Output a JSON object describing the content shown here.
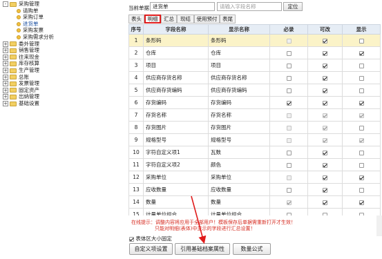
{
  "tree": [
    {
      "label": "采购管理",
      "level": 1,
      "kind": "folder",
      "toggle": "-"
    },
    {
      "label": "请购单",
      "level": 2,
      "kind": "leaf"
    },
    {
      "label": "采购订单",
      "level": 2,
      "kind": "leaf"
    },
    {
      "label": "进货单",
      "level": 2,
      "kind": "leaf",
      "selected": true
    },
    {
      "label": "采购发票",
      "level": 2,
      "kind": "leaf"
    },
    {
      "label": "采购需求分析",
      "level": 2,
      "kind": "leaf"
    },
    {
      "label": "委外管理",
      "level": 0,
      "kind": "folder",
      "toggle": "+"
    },
    {
      "label": "销售管理",
      "level": 0,
      "kind": "folder",
      "toggle": "+"
    },
    {
      "label": "往来现金",
      "level": 0,
      "kind": "folder",
      "toggle": "+"
    },
    {
      "label": "库存核算",
      "level": 0,
      "kind": "folder",
      "toggle": "+"
    },
    {
      "label": "生产管理",
      "level": 0,
      "kind": "folder",
      "toggle": "+"
    },
    {
      "label": "总账",
      "level": 0,
      "kind": "folder",
      "toggle": "+"
    },
    {
      "label": "发票管理",
      "level": 0,
      "kind": "folder",
      "toggle": "+"
    },
    {
      "label": "固定资产",
      "level": 0,
      "kind": "folder",
      "toggle": "+"
    },
    {
      "label": "出纳管理",
      "level": 0,
      "kind": "folder",
      "toggle": "+"
    },
    {
      "label": "基础设置",
      "level": 0,
      "kind": "folder",
      "toggle": "+"
    }
  ],
  "header": {
    "current_doc_label": "当前单据",
    "current_doc_value": "进货单",
    "search_placeholder": "请输入字段名称",
    "locate_button": "定位"
  },
  "tabs": [
    "表头",
    "明细",
    "汇总",
    "现结",
    "使用预付",
    "表尾"
  ],
  "active_tab": "明细",
  "grid": {
    "columns": [
      "序号",
      "字段名称",
      "显示名称",
      "必录",
      "可改",
      "显示"
    ],
    "rows": [
      {
        "no": "1",
        "field": "条形码",
        "display": "条形码",
        "req": false,
        "edit": true,
        "show": false,
        "req_dis": true,
        "edit_dis": false,
        "show_dis": false
      },
      {
        "no": "2",
        "field": "仓库",
        "display": "仓库",
        "req": false,
        "edit": true,
        "show": true,
        "req_dis": false,
        "edit_dis": false,
        "show_dis": false
      },
      {
        "no": "3",
        "field": "项目",
        "display": "项目",
        "req": false,
        "edit": true,
        "show": false,
        "req_dis": false,
        "edit_dis": false,
        "show_dis": false
      },
      {
        "no": "4",
        "field": "供应商存货名称",
        "display": "供应商存货名称",
        "req": false,
        "edit": true,
        "show": false,
        "req_dis": false,
        "edit_dis": false,
        "show_dis": false
      },
      {
        "no": "5",
        "field": "供应商存货编码",
        "display": "供应商存货编码",
        "req": false,
        "edit": true,
        "show": false,
        "req_dis": false,
        "edit_dis": false,
        "show_dis": false
      },
      {
        "no": "6",
        "field": "存货编码",
        "display": "存货编码",
        "req": true,
        "edit": true,
        "show": true,
        "req_dis": false,
        "edit_dis": false,
        "show_dis": false
      },
      {
        "no": "7",
        "field": "存货名称",
        "display": "存货名称",
        "req": false,
        "edit": true,
        "show": true,
        "req_dis": true,
        "edit_dis": true,
        "show_dis": true
      },
      {
        "no": "8",
        "field": "存货图片",
        "display": "存货图片",
        "req": false,
        "edit": true,
        "show": false,
        "req_dis": true,
        "edit_dis": true,
        "show_dis": false
      },
      {
        "no": "9",
        "field": "规格型号",
        "display": "规格型号",
        "req": false,
        "edit": true,
        "show": true,
        "req_dis": true,
        "edit_dis": true,
        "show_dis": true
      },
      {
        "no": "10",
        "field": "字符自定义项1",
        "display": "瓦数",
        "req": false,
        "edit": true,
        "show": false,
        "req_dis": false,
        "edit_dis": false,
        "show_dis": false
      },
      {
        "no": "11",
        "field": "字符自定义项2",
        "display": "颜色",
        "req": false,
        "edit": true,
        "show": false,
        "req_dis": false,
        "edit_dis": false,
        "show_dis": false
      },
      {
        "no": "12",
        "field": "采购单位",
        "display": "采购单位",
        "req": false,
        "edit": true,
        "show": true,
        "req_dis": true,
        "edit_dis": false,
        "show_dis": false
      },
      {
        "no": "13",
        "field": "应收数量",
        "display": "应收数量",
        "req": false,
        "edit": true,
        "show": false,
        "req_dis": false,
        "edit_dis": false,
        "show_dis": false
      },
      {
        "no": "14",
        "field": "数量",
        "display": "数量",
        "req": true,
        "edit": true,
        "show": true,
        "req_dis": true,
        "edit_dis": false,
        "show_dis": false
      },
      {
        "no": "15",
        "field": "计量单位组合",
        "display": "计量单位组合",
        "req": false,
        "edit": false,
        "show": false,
        "req_dis": false,
        "edit_dis": false,
        "show_dis": false
      }
    ]
  },
  "notes": {
    "line1": "在线提示：调整内容将应用于全部用户！模板保存后单据需重新打开才生效！",
    "line2": "只能对明细(表体)中显示的字段进行汇总设置！"
  },
  "fixed_body_size_label": "表体区大小固定",
  "fixed_body_size_checked": true,
  "buttons": {
    "custom": "自定义项设置",
    "reference": "引用基础档案属性",
    "formula": "数量公式"
  },
  "colors": {
    "highlight_row": "#fbf3c8",
    "active_tab_border": "#e01b1b",
    "note_text": "#d62a1f",
    "arrow": "#e01b1b"
  }
}
